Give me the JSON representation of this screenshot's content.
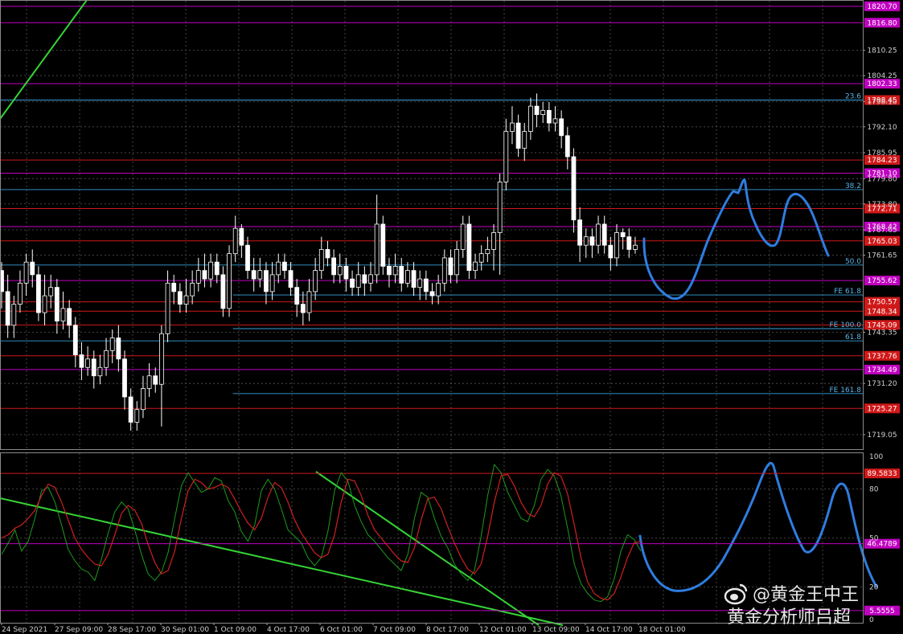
{
  "chart_data": {
    "type": "candlestick",
    "symbol_note": "XAUUSD H4 with stochastic oscillator",
    "price_axis": {
      "ylim": [
        1715.6,
        1822.0
      ],
      "ticks": [
        "1810.25",
        "1804.25",
        "1798.10",
        "1792.10",
        "1785.95",
        "1779.80",
        "1773.80",
        "1767.65",
        "1761.65",
        "1743.35",
        "1731.20",
        "1719.05"
      ]
    },
    "time_axis": {
      "labels": [
        "24 Sep 2021",
        "27 Sep 09:00",
        "28 Sep 17:00",
        "30 Sep 01:00",
        "1 Oct 09:00",
        "4 Oct 17:00",
        "6 Oct 01:00",
        "7 Oct 09:00",
        "8 Oct 17:00",
        "12 Oct 01:00",
        "13 Oct 09:00",
        "14 Oct 17:00",
        "18 Oct 01:00"
      ]
    },
    "candles": [
      [
        1758,
        1753,
        1760,
        1749
      ],
      [
        1753,
        1745,
        1757,
        1742
      ],
      [
        1745,
        1750,
        1752,
        1742
      ],
      [
        1750,
        1755,
        1758,
        1748
      ],
      [
        1755,
        1760,
        1762,
        1752
      ],
      [
        1760,
        1757,
        1763,
        1754
      ],
      [
        1757,
        1748,
        1759,
        1746
      ],
      [
        1748,
        1752,
        1757,
        1745
      ],
      [
        1752,
        1754,
        1757,
        1749
      ],
      [
        1754,
        1746,
        1756,
        1743
      ],
      [
        1746,
        1749,
        1753,
        1744
      ],
      [
        1749,
        1745,
        1751,
        1742
      ],
      [
        1745,
        1738,
        1747,
        1735
      ],
      [
        1738,
        1735,
        1741,
        1732
      ],
      [
        1735,
        1737,
        1740,
        1733
      ],
      [
        1737,
        1733,
        1739,
        1730
      ],
      [
        1733,
        1735,
        1738,
        1731
      ],
      [
        1735,
        1739,
        1742,
        1733
      ],
      [
        1739,
        1742,
        1744,
        1736
      ],
      [
        1742,
        1737,
        1745,
        1734
      ],
      [
        1737,
        1728,
        1739,
        1725
      ],
      [
        1728,
        1722,
        1730,
        1720
      ],
      [
        1722,
        1725,
        1727,
        1720
      ],
      [
        1725,
        1730,
        1733,
        1723
      ],
      [
        1730,
        1733,
        1736,
        1728
      ],
      [
        1733,
        1731,
        1735,
        1729
      ],
      [
        1731,
        1743,
        1745,
        1721
      ],
      [
        1743,
        1755,
        1758,
        1741
      ],
      [
        1755,
        1753,
        1757,
        1750
      ],
      [
        1753,
        1750,
        1755,
        1748
      ],
      [
        1750,
        1752,
        1756,
        1748
      ],
      [
        1752,
        1755,
        1758,
        1750
      ],
      [
        1755,
        1758,
        1761,
        1753
      ],
      [
        1758,
        1756,
        1762,
        1754
      ],
      [
        1756,
        1760,
        1762,
        1754
      ],
      [
        1760,
        1757,
        1762,
        1755
      ],
      [
        1757,
        1749,
        1759,
        1747
      ],
      [
        1749,
        1762,
        1764,
        1747
      ],
      [
        1762,
        1768,
        1771,
        1760
      ],
      [
        1768,
        1764,
        1769,
        1761
      ],
      [
        1764,
        1758,
        1766,
        1756
      ],
      [
        1758,
        1756,
        1761,
        1753
      ],
      [
        1756,
        1758,
        1761,
        1754
      ],
      [
        1758,
        1753,
        1760,
        1750
      ],
      [
        1753,
        1757,
        1760,
        1751
      ],
      [
        1757,
        1760,
        1762,
        1755
      ],
      [
        1760,
        1758,
        1762,
        1756
      ],
      [
        1758,
        1754,
        1760,
        1752
      ],
      [
        1754,
        1750,
        1756,
        1747
      ],
      [
        1750,
        1748,
        1753,
        1745
      ],
      [
        1748,
        1753,
        1756,
        1746
      ],
      [
        1753,
        1758,
        1761,
        1751
      ],
      [
        1758,
        1763,
        1766,
        1756
      ],
      [
        1763,
        1761,
        1765,
        1759
      ],
      [
        1761,
        1757,
        1763,
        1755
      ],
      [
        1757,
        1759,
        1762,
        1755
      ],
      [
        1759,
        1756,
        1761,
        1753
      ],
      [
        1756,
        1754,
        1758,
        1752
      ],
      [
        1754,
        1757,
        1760,
        1752
      ],
      [
        1757,
        1755,
        1759,
        1752
      ],
      [
        1755,
        1757,
        1760,
        1753
      ],
      [
        1757,
        1769,
        1776,
        1755
      ],
      [
        1769,
        1759,
        1771,
        1757
      ],
      [
        1759,
        1757,
        1761,
        1754
      ],
      [
        1757,
        1759,
        1762,
        1755
      ],
      [
        1759,
        1755,
        1761,
        1753
      ],
      [
        1755,
        1758,
        1760,
        1754
      ],
      [
        1758,
        1754,
        1760,
        1752
      ],
      [
        1754,
        1756,
        1758,
        1751
      ],
      [
        1756,
        1753,
        1758,
        1751
      ],
      [
        1753,
        1752,
        1755,
        1750
      ],
      [
        1752,
        1755,
        1757,
        1750
      ],
      [
        1755,
        1761,
        1763,
        1753
      ],
      [
        1761,
        1757,
        1763,
        1755
      ],
      [
        1757,
        1763,
        1765,
        1755
      ],
      [
        1763,
        1769,
        1771,
        1761
      ],
      [
        1769,
        1758,
        1771,
        1756
      ],
      [
        1758,
        1760,
        1762,
        1756
      ],
      [
        1760,
        1762,
        1764,
        1758
      ],
      [
        1762,
        1763,
        1766,
        1760
      ],
      [
        1763,
        1767,
        1769,
        1758
      ],
      [
        1767,
        1779,
        1781,
        1757
      ],
      [
        1779,
        1791,
        1794,
        1777
      ],
      [
        1791,
        1793,
        1797,
        1788
      ],
      [
        1793,
        1787,
        1795,
        1785
      ],
      [
        1787,
        1791,
        1793,
        1784
      ],
      [
        1791,
        1797,
        1799,
        1789
      ],
      [
        1797,
        1795,
        1800,
        1792
      ],
      [
        1795,
        1796,
        1798,
        1793
      ],
      [
        1796,
        1793,
        1798,
        1791
      ],
      [
        1793,
        1794,
        1797,
        1791
      ],
      [
        1794,
        1790,
        1796,
        1787
      ],
      [
        1790,
        1785,
        1792,
        1782
      ],
      [
        1785,
        1770,
        1787,
        1767
      ],
      [
        1770,
        1764,
        1773,
        1760
      ],
      [
        1764,
        1766,
        1768,
        1761
      ],
      [
        1766,
        1764,
        1768,
        1761
      ],
      [
        1764,
        1769,
        1771,
        1762
      ],
      [
        1769,
        1764,
        1771,
        1762
      ],
      [
        1764,
        1761,
        1766,
        1758
      ],
      [
        1761,
        1767,
        1769,
        1759
      ],
      [
        1767,
        1766,
        1768,
        1763
      ],
      [
        1766,
        1763,
        1768,
        1761
      ],
      [
        1763,
        1764,
        1766,
        1762
      ]
    ],
    "levels": [
      {
        "price": 1820.7,
        "label": "1820.70",
        "color": "#c000c0",
        "kind": "magenta"
      },
      {
        "price": 1816.8,
        "label": "1816.80",
        "color": "#c000c0",
        "kind": "magenta"
      },
      {
        "price": 1802.33,
        "label": "1802.33",
        "color": "#c000c0",
        "kind": "magenta"
      },
      {
        "price": 1798.45,
        "label": "1798.45",
        "color": "#d01818",
        "kind": "red"
      },
      {
        "price": 1784.23,
        "label": "1784.23",
        "color": "#d01818",
        "kind": "red"
      },
      {
        "price": 1781.1,
        "label": "1781.10",
        "color": "#c000c0",
        "kind": "magenta"
      },
      {
        "price": 1772.71,
        "label": "1772.71",
        "color": "#d01818",
        "kind": "red"
      },
      {
        "price": 1768.42,
        "label": "1768.42",
        "color": "#c000c0",
        "kind": "magenta"
      },
      {
        "price": 1765.03,
        "label": "1765.03",
        "color": "#d01818",
        "kind": "red"
      },
      {
        "price": 1755.62,
        "label": "1755.62",
        "color": "#c000c0",
        "kind": "magenta"
      },
      {
        "price": 1750.57,
        "label": "1750.57",
        "color": "#d01818",
        "kind": "red"
      },
      {
        "price": 1748.34,
        "label": "1748.34",
        "color": "#d01818",
        "kind": "red"
      },
      {
        "price": 1745.09,
        "label": "1745.09",
        "color": "#d01818",
        "kind": "red"
      },
      {
        "price": 1737.76,
        "label": "1737.76",
        "color": "#d01818",
        "kind": "red"
      },
      {
        "price": 1734.49,
        "label": "1734.49",
        "color": "#c000c0",
        "kind": "magenta"
      },
      {
        "price": 1725.27,
        "label": "1725.27",
        "color": "#d01818",
        "kind": "red"
      }
    ],
    "fib_levels": [
      {
        "price": 1798.45,
        "label": "23.6",
        "start": 0
      },
      {
        "price": 1777.2,
        "label": "38.2",
        "start": 0
      },
      {
        "price": 1759.3,
        "label": "50.0",
        "start": 0
      },
      {
        "price": 1752.2,
        "label": "FE 61.8",
        "start": 0.27
      },
      {
        "price": 1741.3,
        "label": "61.8",
        "start": 0
      },
      {
        "price": 1744.2,
        "label": "FE 100.0",
        "start": 0.27
      },
      {
        "price": 1728.8,
        "label": "FE 161.8",
        "start": 0.27
      }
    ],
    "stochastic": {
      "ylim": [
        0,
        100
      ],
      "ticks": [
        "100",
        "80",
        "50",
        "20",
        "0"
      ],
      "levels": [
        {
          "value": 89.5833,
          "label": "89.5833",
          "kind": "red"
        },
        {
          "value": 46.4789,
          "label": "46.4789",
          "kind": "magenta"
        },
        {
          "value": 5.5,
          "label": "5.5555",
          "kind": "magenta"
        }
      ],
      "k": [
        40,
        47,
        55,
        42,
        48,
        62,
        79,
        81,
        72,
        58,
        43,
        36,
        31,
        29,
        24,
        37,
        53,
        66,
        72,
        68,
        55,
        40,
        28,
        24,
        29,
        41,
        62,
        82,
        90,
        84,
        78,
        80,
        87,
        85,
        73,
        66,
        54,
        48,
        58,
        79,
        86,
        80,
        68,
        55,
        51,
        47,
        38,
        33,
        38,
        54,
        79,
        90,
        85,
        70,
        60,
        52,
        48,
        43,
        38,
        34,
        30,
        40,
        62,
        78,
        75,
        62,
        51,
        44,
        34,
        28,
        24,
        30,
        51,
        76,
        95,
        90,
        78,
        70,
        62,
        60,
        70,
        86,
        92,
        88,
        76,
        56,
        34,
        22,
        16,
        12,
        11,
        14,
        25,
        42,
        52,
        49,
        42
      ],
      "d": [
        50,
        52,
        56,
        58,
        62,
        67,
        76,
        83,
        81,
        72,
        61,
        50,
        43,
        38,
        34,
        33,
        40,
        52,
        65,
        70,
        67,
        59,
        46,
        35,
        28,
        30,
        42,
        62,
        79,
        86,
        84,
        80,
        81,
        83,
        81,
        74,
        66,
        59,
        55,
        62,
        75,
        84,
        81,
        72,
        61,
        53,
        47,
        41,
        38,
        40,
        52,
        72,
        86,
        85,
        76,
        64,
        55,
        50,
        45,
        40,
        36,
        35,
        44,
        61,
        74,
        75,
        68,
        57,
        47,
        38,
        31,
        28,
        34,
        51,
        72,
        88,
        89,
        82,
        72,
        65,
        63,
        70,
        83,
        90,
        88,
        77,
        58,
        38,
        23,
        16,
        13,
        12,
        16,
        26,
        38,
        47,
        48
      ]
    }
  },
  "watermark": {
    "line1": "@黄金王中王",
    "line2": "黄金分析师吕超"
  }
}
